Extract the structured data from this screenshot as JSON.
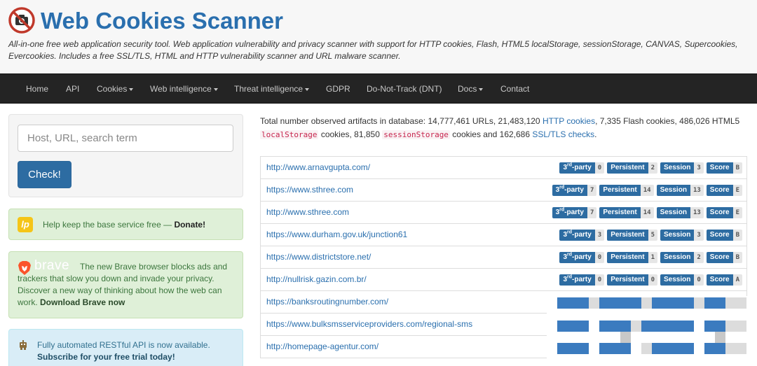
{
  "header": {
    "title": "Web Cookies Scanner",
    "tagline": "All-in-one free web application security tool. Web application vulnerability and privacy scanner with support for HTTP cookies, Flash, HTML5 localStorage, sessionStorage, CANVAS, Supercookies, Evercookies. Includes a free SSL/TLS, HTML and HTTP vulnerability scanner and URL malware scanner.",
    "logo_icon": "no-camera-icon"
  },
  "nav": {
    "items": [
      {
        "label": "Home"
      },
      {
        "label": "API"
      },
      {
        "label": "Cookies"
      },
      {
        "label": "Web intelligence"
      },
      {
        "label": "Threat intelligence"
      },
      {
        "label": "GDPR"
      },
      {
        "label": "Do-Not-Track (DNT)"
      },
      {
        "label": "Docs"
      },
      {
        "label": "Contact"
      }
    ]
  },
  "search": {
    "placeholder": "Host, URL, search term",
    "button_label": "Check!"
  },
  "donate": {
    "icon_letter": "lp",
    "text": "Help keep the base service free — ",
    "link": "Donate!"
  },
  "brave": {
    "logo_word": "brave",
    "text": "The new Brave browser blocks ads and trackers that slow you down and invade your privacy. Discover a new way of thinking about how the web can work. ",
    "link": "Download Brave now"
  },
  "api_promo": {
    "icon": "robot-icon",
    "text": "Fully automated RESTful API is now available.",
    "link": "Subscribe for your free trial today!"
  },
  "stats": {
    "prefix": "Total number observed artifacts in database: 14,777,461 URLs, 21,483,120 ",
    "http_cookies_link": "HTTP cookies",
    "mid1": ", 7,335 Flash cookies, 486,026 HTML5 ",
    "local_storage": "localStorage",
    "mid2": " cookies, 81,850 ",
    "session_storage": "sessionStorage",
    "mid3": " cookies and 162,686 ",
    "ssl_link": "SSL/TLS checks",
    "suffix": "."
  },
  "badge_labels": {
    "third_party_num": "3",
    "third_party_sup": "rd",
    "third_party_rest": "-party",
    "persistent": "Persistent",
    "session": "Session",
    "score": "Score"
  },
  "results": [
    {
      "url": "http://www.arnavgupta.com/",
      "third_party": "0",
      "persistent": "2",
      "session": "3",
      "score": "B"
    },
    {
      "url": "https://www.sthree.com",
      "third_party": "7",
      "persistent": "14",
      "session": "13",
      "score": "E"
    },
    {
      "url": "http://www.sthree.com",
      "third_party": "7",
      "persistent": "14",
      "session": "13",
      "score": "E"
    },
    {
      "url": "https://www.durham.gov.uk/junction61",
      "third_party": "3",
      "persistent": "5",
      "session": "3",
      "score": "B"
    },
    {
      "url": "https://www.districtstore.net/",
      "third_party": "0",
      "persistent": "1",
      "session": "2",
      "score": "B"
    },
    {
      "url": "http://nullrisk.gazin.com.br/",
      "third_party": "0",
      "persistent": "0",
      "session": "0",
      "score": "A"
    },
    {
      "url": "https://banksroutingnumber.com/"
    },
    {
      "url": "https://www.bulksmsserviceproviders.com/regional-sms"
    },
    {
      "url": "http://homepage-agentur.com/"
    }
  ],
  "colors": {
    "brand_blue": "#2a6fae",
    "badge_blue": "#2d6ca2",
    "navbar": "#242424",
    "success_bg": "#dff0d8",
    "info_bg": "#d9edf7"
  }
}
